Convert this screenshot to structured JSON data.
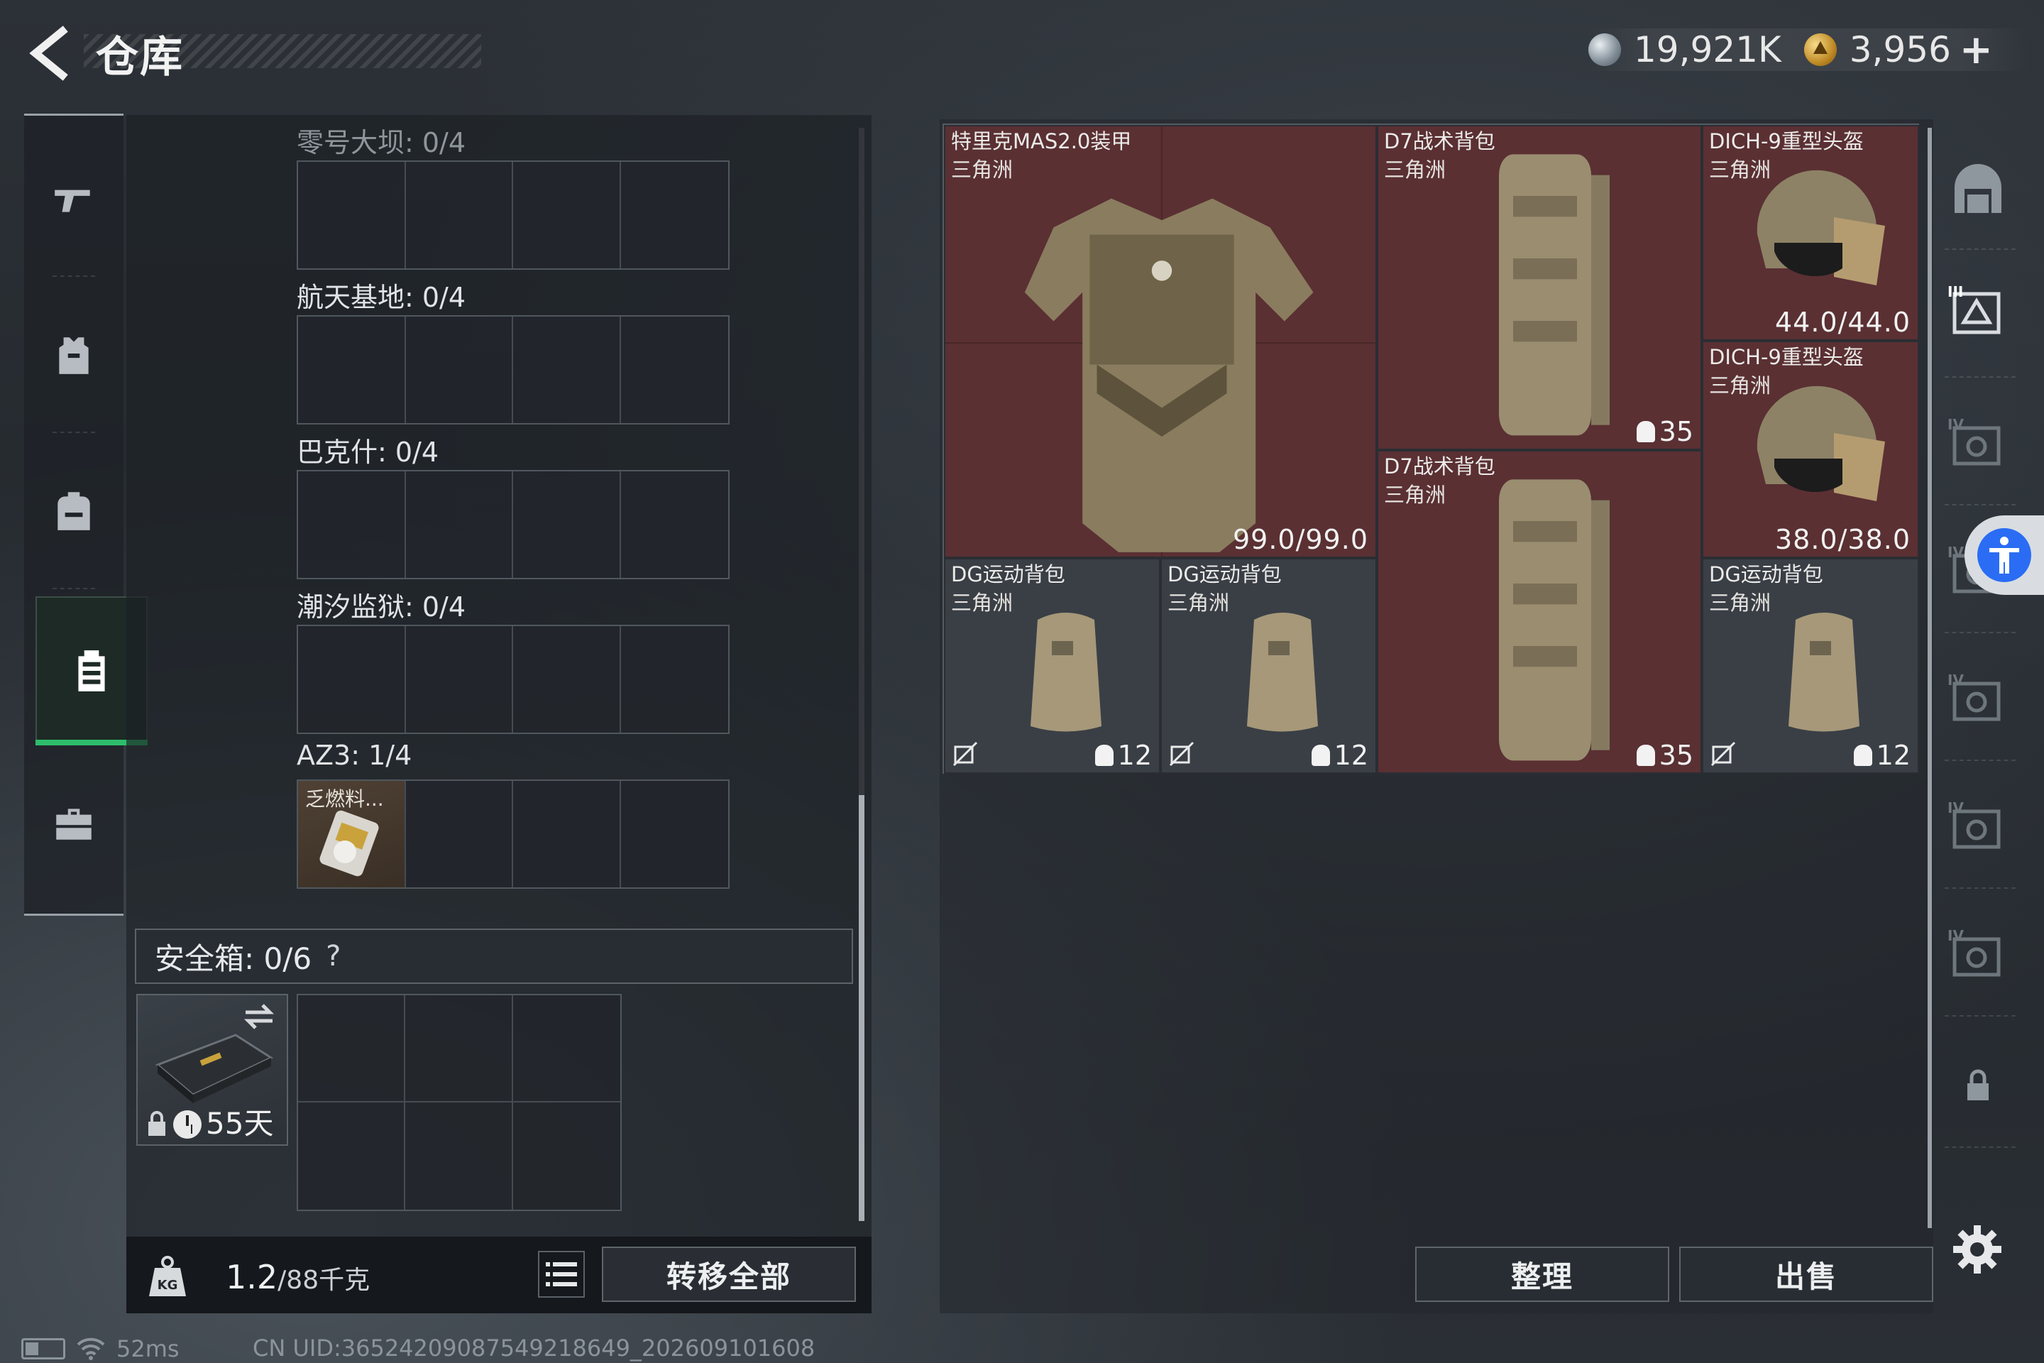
{
  "header": {
    "title": "仓库",
    "currency_silver": "19,921K",
    "currency_gold": "3,956",
    "plus": "+"
  },
  "left_rail": {
    "tabs": [
      {
        "name": "weapon",
        "icon": "pistol-icon"
      },
      {
        "name": "armor",
        "icon": "vest-icon"
      },
      {
        "name": "backpack",
        "icon": "backpack-icon"
      },
      {
        "name": "chest-rig",
        "icon": "chest-rig-icon",
        "active": true
      },
      {
        "name": "case",
        "icon": "briefcase-icon"
      }
    ]
  },
  "pouches": [
    {
      "label": "零号大坝: 0/4"
    },
    {
      "label": "航天基地: 0/4"
    },
    {
      "label": "巴克什: 0/4"
    },
    {
      "label": "潮汐监狱: 0/4"
    },
    {
      "label": "AZ3: 1/4",
      "item_name": "乏燃料..."
    }
  ],
  "safe_box": {
    "label": "安全箱: 0/6",
    "help": "?",
    "days": "55天"
  },
  "footer": {
    "weight": "1.2",
    "weight_max": "/88千克",
    "transfer_all": "转移全部"
  },
  "storage_items": [
    {
      "name": "特里克MAS2.0装甲",
      "sub": "三角洲",
      "durability": "99.0/99.0"
    },
    {
      "name": "D7战术背包",
      "sub": "三角洲",
      "capacity": "35"
    },
    {
      "name": "DICH-9重型头盔",
      "sub": "三角洲",
      "durability": "44.0/44.0"
    },
    {
      "name": "DICH-9重型头盔",
      "sub": "三角洲",
      "durability": "38.0/38.0"
    },
    {
      "name": "D7战术背包",
      "sub": "三角洲",
      "capacity": "35"
    },
    {
      "name": "DG运动背包",
      "sub": "三角洲",
      "capacity": "12"
    },
    {
      "name": "DG运动背包",
      "sub": "三角洲",
      "capacity": "12"
    },
    {
      "name": "DG运动背包",
      "sub": "三角洲",
      "capacity": "12"
    }
  ],
  "right_rail": {
    "tier_labels": [
      "III",
      "IV",
      "IV",
      "IV",
      "IV",
      "IV"
    ]
  },
  "buttons": {
    "sort": "整理",
    "sell": "出售"
  },
  "status": {
    "ping": "52ms",
    "uid": "CN UID:36524209087549218649_202609101608"
  },
  "colors": {
    "accent_green": "#2dbd6c",
    "item_red": "#5a3033",
    "accessibility_blue": "#2a6df4"
  }
}
